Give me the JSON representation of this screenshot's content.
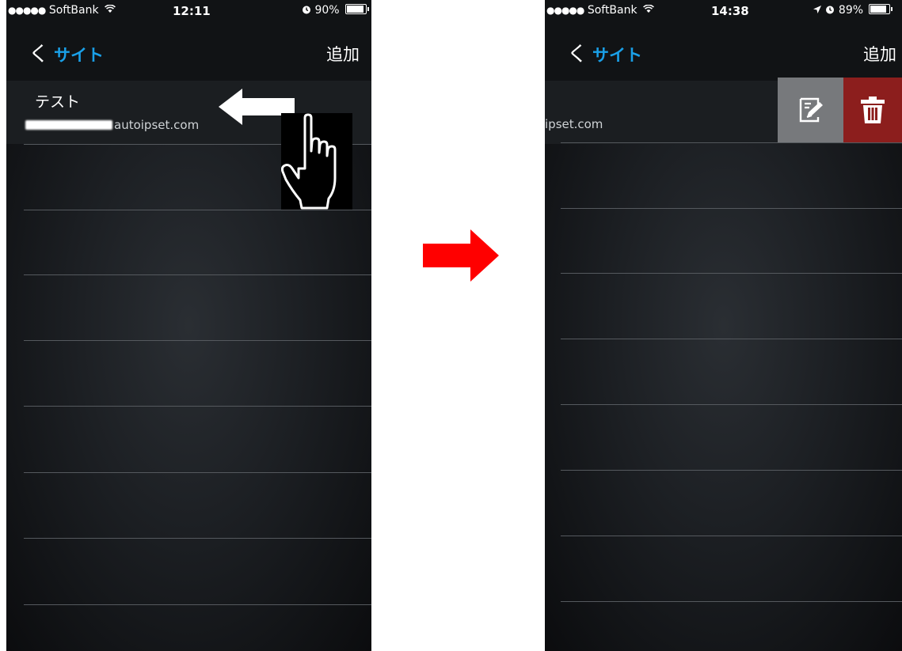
{
  "before_screen": {
    "status_bar": {
      "signal_dots": "●●●●●",
      "carrier": "SoftBank",
      "wifi_icon": "wifi-icon",
      "time": "12:11",
      "alarm_icon": "alarm-icon",
      "battery_percent": "90%",
      "battery_level": 0.9
    },
    "nav": {
      "back_chevron": "く",
      "back_label": "サイト",
      "add_label": "追加"
    },
    "list_item": {
      "title": "テスト",
      "url_visible": "autoipset.com"
    },
    "gesture": {
      "arrow_icon": "left-arrow-icon",
      "hand_icon": "pointing-hand-icon"
    }
  },
  "transition": {
    "arrow_icon": "right-arrow-icon",
    "color": "#ff0000"
  },
  "after_screen": {
    "status_bar": {
      "signal_dots": "●●●●●",
      "carrier": "SoftBank",
      "wifi_icon": "wifi-icon",
      "time": "14:38",
      "location_icon": "location-arrow-icon",
      "alarm_icon": "alarm-icon",
      "battery_percent": "89%",
      "battery_level": 0.89
    },
    "nav": {
      "back_chevron": "く",
      "back_label": "サイト",
      "add_label": "追加"
    },
    "list_item": {
      "url_visible": "ipset.com"
    },
    "actions": {
      "edit_icon": "edit-icon",
      "edit_color": "#77797c",
      "delete_icon": "trash-icon",
      "delete_color": "#8c1e1d"
    }
  },
  "colors": {
    "accent_blue": "#1aa0e8",
    "background_dark": "#1c1f23"
  }
}
